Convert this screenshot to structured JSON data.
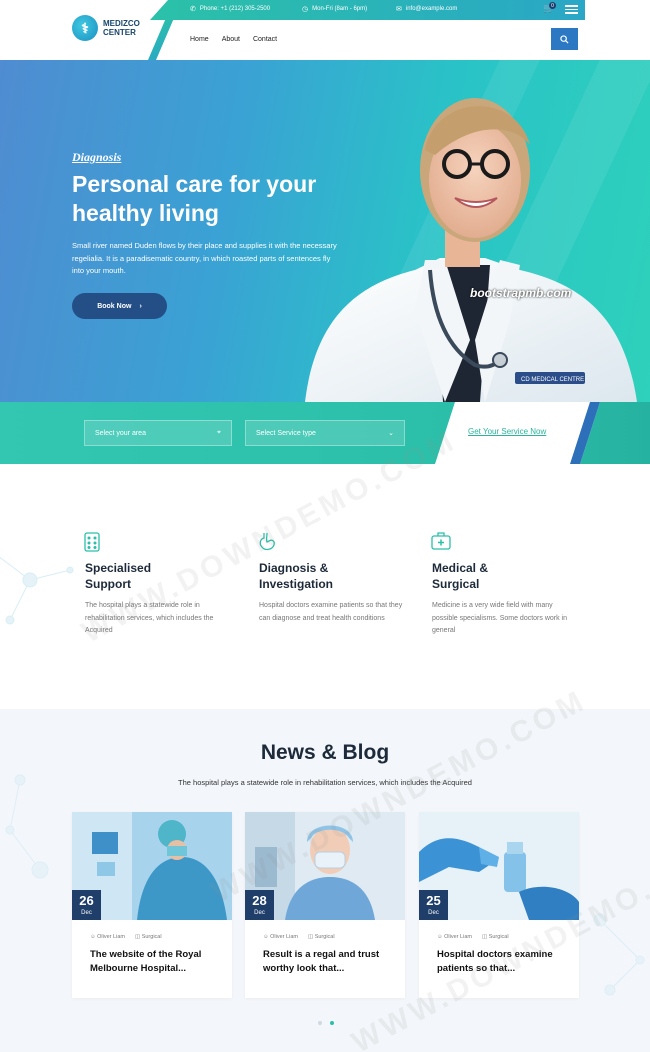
{
  "header": {
    "logo": {
      "line1": "MEDIZCO",
      "line2": "CENTER"
    },
    "topbar": {
      "phone": "Phone: +1 (212) 305-2500",
      "hours": "Mon-Fri (8am - 6pm)",
      "email": "info@example.com",
      "cart_count": "0"
    },
    "nav": [
      "Home",
      "About",
      "Contact"
    ]
  },
  "hero": {
    "eyebrow": "Diagnosis",
    "title": "Personal care for your healthy living",
    "text": "Small river named Duden flows by their place and supplies it with the necessary regelialia. It is a paradisematic country, in which roasted parts of sentences fly into your mouth.",
    "button": "Book Now",
    "badge": "CD MEDICAL CENTRE",
    "watermark": "bootstrapmb.com"
  },
  "search": {
    "area_placeholder": "Select your area",
    "service_placeholder": "Select Service type",
    "cta": "Get Your Service Now"
  },
  "features": [
    {
      "title_1": "Specialised",
      "title_2": "Support",
      "text": "The hospital plays a statewide role in rehabilitation services, which includes the Acquired",
      "icon": "grid-icon"
    },
    {
      "title_1": "Diagnosis &",
      "title_2": "Investigation",
      "text": "Hospital doctors examine patients so that they can diagnose and treat health conditions",
      "icon": "stomach-icon"
    },
    {
      "title_1": "Medical &",
      "title_2": "Surgical",
      "text": "Medicine is a very wide field with many possible specialisms. Some doctors work in general",
      "icon": "medkit-icon"
    }
  ],
  "blog": {
    "title": "News & Blog",
    "subtitle": "The hospital plays a statewide role in rehabilitation services, which includes the Acquired",
    "posts": [
      {
        "day": "26",
        "month": "Dec",
        "author": "Oliver Liam",
        "category": "Surgical",
        "title": "The website of the Royal Melbourne Hospital..."
      },
      {
        "day": "28",
        "month": "Dec",
        "author": "Oliver Liam",
        "category": "Surgical",
        "title": "Result is a regal and trust worthy look that..."
      },
      {
        "day": "25",
        "month": "Dec",
        "author": "Oliver Liam",
        "category": "Surgical",
        "title": "Hospital doctors examine patients so that..."
      }
    ]
  },
  "watermark": "WWW.DOWNDEMO.COM",
  "colors": {
    "teal": "#2bbfa9",
    "navy": "#1f3e6a",
    "blue": "#2c78c3"
  }
}
